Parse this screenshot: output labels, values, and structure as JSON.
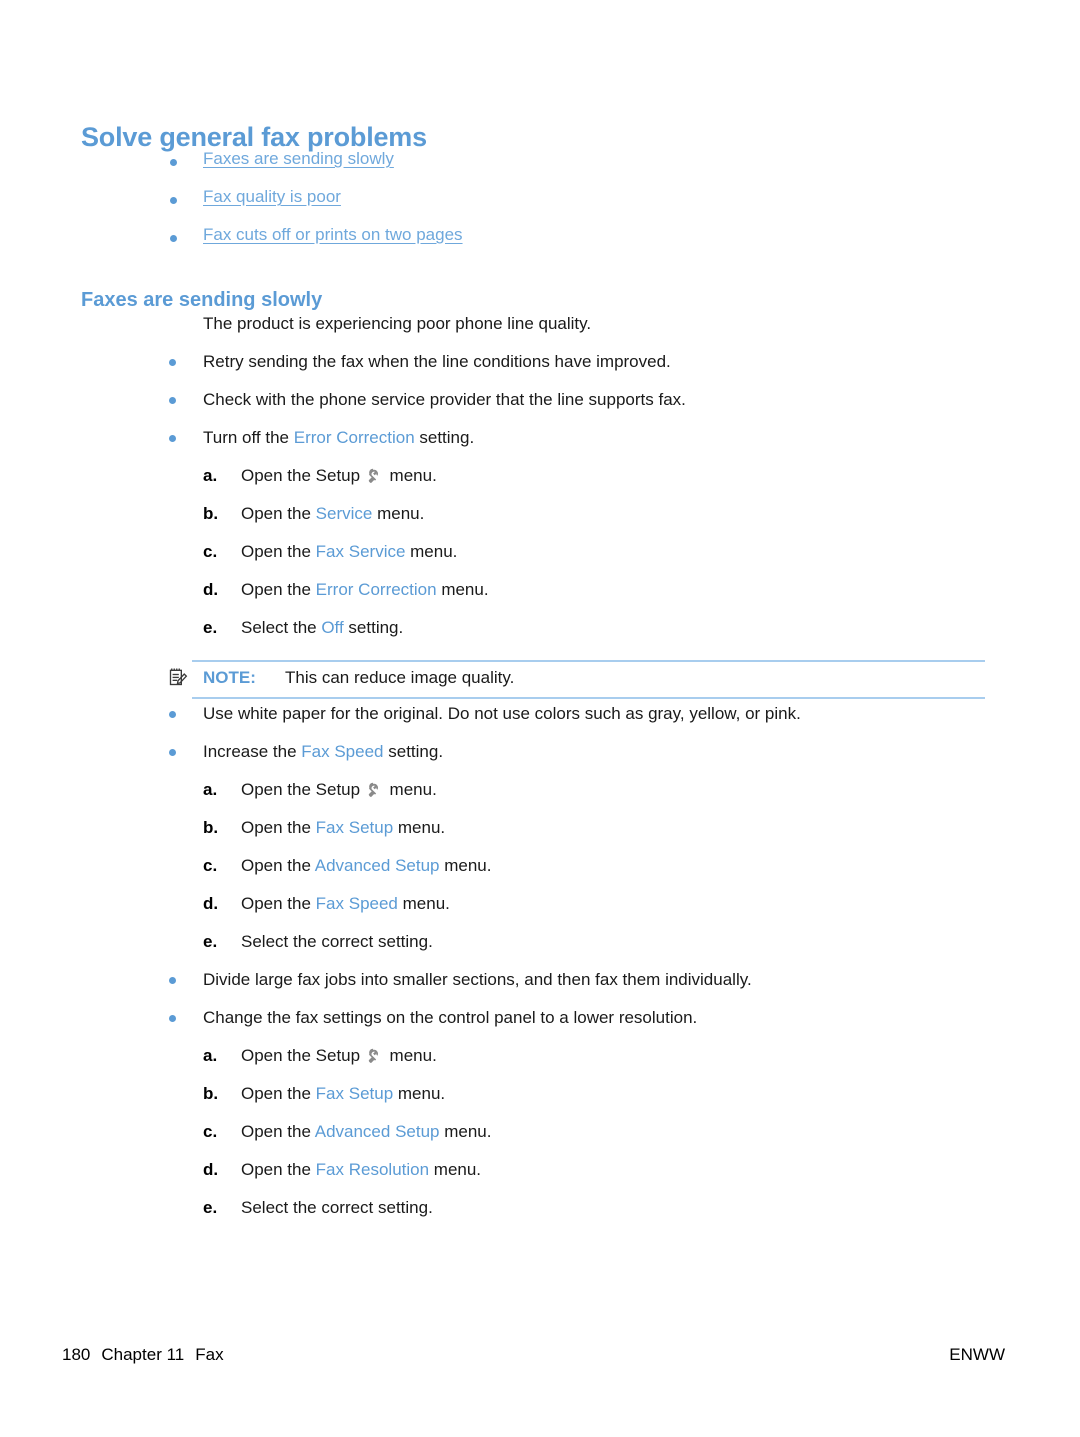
{
  "document": {
    "title": "Solve general fax problems",
    "section_heading": "Faxes are sending slowly",
    "intro_paragraph": "The product is experiencing poor phone line quality."
  },
  "colors": {
    "heading_blue": "#5B9BD5",
    "link_blue": "#6FA8DC",
    "ui_text_blue": "#5B9BD5",
    "rule_blue": "#A8CDEE",
    "body_text": "#1a1a1a"
  },
  "toc": {
    "items": [
      {
        "label": "Faxes are sending slowly"
      },
      {
        "label": "Fax quality is poor"
      },
      {
        "label": "Fax cuts off or prints on two pages"
      }
    ]
  },
  "bullets": [
    {
      "id": "retry-sending",
      "parts": [
        {
          "text": "Retry sending the fax when the line conditions have improved.",
          "style": "plain"
        }
      ]
    },
    {
      "id": "check-provider",
      "parts": [
        {
          "text": "Check with the phone service provider that the line supports fax.",
          "style": "plain"
        }
      ]
    },
    {
      "id": "turn-off-error-correction",
      "parts": [
        {
          "text": "Turn off the ",
          "style": "plain"
        },
        {
          "text": "Error Correction",
          "style": "ui"
        },
        {
          "text": " setting.",
          "style": "plain"
        }
      ],
      "steps": [
        {
          "marker": "a.",
          "parts": [
            {
              "text": "Open the Setup ",
              "style": "plain"
            },
            {
              "text": "",
              "style": "wrench-icon"
            },
            {
              "text": " menu.",
              "style": "plain"
            }
          ]
        },
        {
          "marker": "b.",
          "parts": [
            {
              "text": "Open the ",
              "style": "plain"
            },
            {
              "text": "Service",
              "style": "ui"
            },
            {
              "text": " menu.",
              "style": "plain"
            }
          ]
        },
        {
          "marker": "c.",
          "parts": [
            {
              "text": "Open the ",
              "style": "plain"
            },
            {
              "text": "Fax Service",
              "style": "ui"
            },
            {
              "text": " menu.",
              "style": "plain"
            }
          ]
        },
        {
          "marker": "d.",
          "parts": [
            {
              "text": "Open the ",
              "style": "plain"
            },
            {
              "text": "Error Correction",
              "style": "ui"
            },
            {
              "text": " menu.",
              "style": "plain"
            }
          ]
        },
        {
          "marker": "e.",
          "parts": [
            {
              "text": "Select the ",
              "style": "plain"
            },
            {
              "text": "Off",
              "style": "ui"
            },
            {
              "text": " setting.",
              "style": "plain"
            }
          ]
        }
      ],
      "note": {
        "icon": "note-pad-pencil-icon",
        "label": "NOTE:",
        "text": "This can reduce image quality."
      }
    },
    {
      "id": "use-white-paper",
      "parts": [
        {
          "text": "Use white paper for the original. Do not use colors such as gray, yellow, or pink.",
          "style": "plain"
        }
      ]
    },
    {
      "id": "increase-fax-speed",
      "parts": [
        {
          "text": "Increase the ",
          "style": "plain"
        },
        {
          "text": "Fax Speed",
          "style": "ui"
        },
        {
          "text": " setting.",
          "style": "plain"
        }
      ],
      "steps": [
        {
          "marker": "a.",
          "parts": [
            {
              "text": "Open the Setup ",
              "style": "plain"
            },
            {
              "text": "",
              "style": "wrench-icon"
            },
            {
              "text": " menu.",
              "style": "plain"
            }
          ]
        },
        {
          "marker": "b.",
          "parts": [
            {
              "text": "Open the ",
              "style": "plain"
            },
            {
              "text": "Fax Setup",
              "style": "ui"
            },
            {
              "text": " menu.",
              "style": "plain"
            }
          ]
        },
        {
          "marker": "c.",
          "parts": [
            {
              "text": "Open the ",
              "style": "plain"
            },
            {
              "text": "Advanced Setup",
              "style": "ui"
            },
            {
              "text": " menu.",
              "style": "plain"
            }
          ]
        },
        {
          "marker": "d.",
          "parts": [
            {
              "text": "Open the ",
              "style": "plain"
            },
            {
              "text": "Fax Speed",
              "style": "ui"
            },
            {
              "text": " menu.",
              "style": "plain"
            }
          ]
        },
        {
          "marker": "e.",
          "parts": [
            {
              "text": "Select the correct setting.",
              "style": "plain"
            }
          ]
        }
      ]
    },
    {
      "id": "divide-large-fax-jobs",
      "parts": [
        {
          "text": "Divide large fax jobs into smaller sections, and then fax them individually.",
          "style": "plain"
        }
      ]
    },
    {
      "id": "lower-resolution",
      "parts": [
        {
          "text": "Change the fax settings on the control panel to a lower resolution.",
          "style": "plain"
        }
      ],
      "steps": [
        {
          "marker": "a.",
          "parts": [
            {
              "text": "Open the Setup ",
              "style": "plain"
            },
            {
              "text": "",
              "style": "wrench-icon"
            },
            {
              "text": " menu.",
              "style": "plain"
            }
          ]
        },
        {
          "marker": "b.",
          "parts": [
            {
              "text": "Open the ",
              "style": "plain"
            },
            {
              "text": "Fax Setup",
              "style": "ui"
            },
            {
              "text": " menu.",
              "style": "plain"
            }
          ]
        },
        {
          "marker": "c.",
          "parts": [
            {
              "text": "Open the ",
              "style": "plain"
            },
            {
              "text": "Advanced Setup",
              "style": "ui"
            },
            {
              "text": " menu.",
              "style": "plain"
            }
          ]
        },
        {
          "marker": "d.",
          "parts": [
            {
              "text": "Open the ",
              "style": "plain"
            },
            {
              "text": "Fax Resolution",
              "style": "ui"
            },
            {
              "text": " menu.",
              "style": "plain"
            }
          ]
        },
        {
          "marker": "e.",
          "parts": [
            {
              "text": "Select the correct setting.",
              "style": "plain"
            }
          ]
        }
      ]
    }
  ],
  "footer": {
    "page_number": "180",
    "chapter": "Chapter 11",
    "chapter_title": "Fax",
    "locale": "ENWW"
  }
}
